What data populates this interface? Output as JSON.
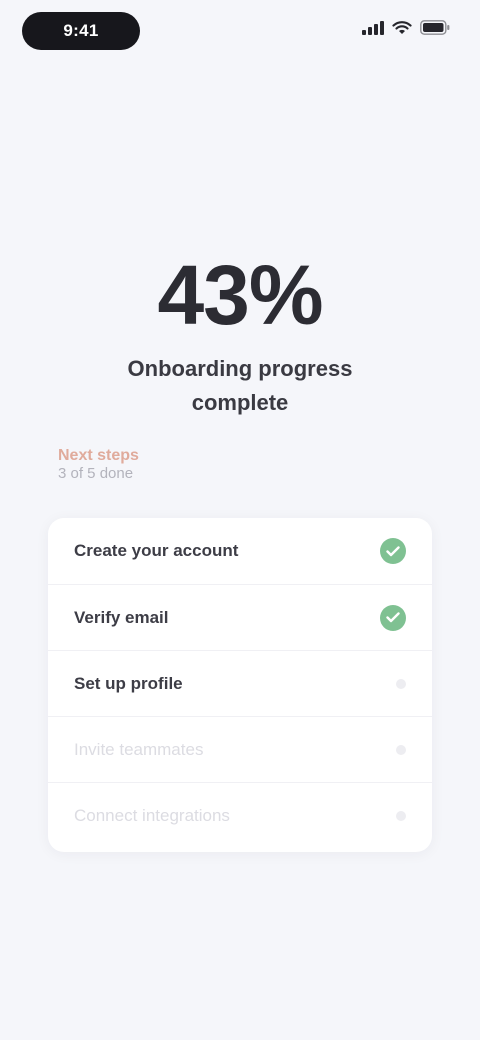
{
  "status_bar": {
    "time": "9:41",
    "signal_icon": "signal-icon",
    "wifi_icon": "wifi-icon",
    "battery_icon": "battery-icon"
  },
  "progress": {
    "value": "43%",
    "caption": "Onboarding progress complete"
  },
  "section": {
    "label": "Next steps",
    "sublabel": "3 of 5 done"
  },
  "tasks": [
    {
      "label": "Create your account",
      "status": "done"
    },
    {
      "label": "Verify email",
      "status": "done"
    },
    {
      "label": "Set up profile",
      "status": "active"
    },
    {
      "label": "Invite teammates",
      "status": "pending"
    },
    {
      "label": "Connect integrations",
      "status": "pending"
    }
  ],
  "colors": {
    "accent": "#7fc192",
    "section_label": "#e0ab9c",
    "background": "#f5f6fa"
  }
}
